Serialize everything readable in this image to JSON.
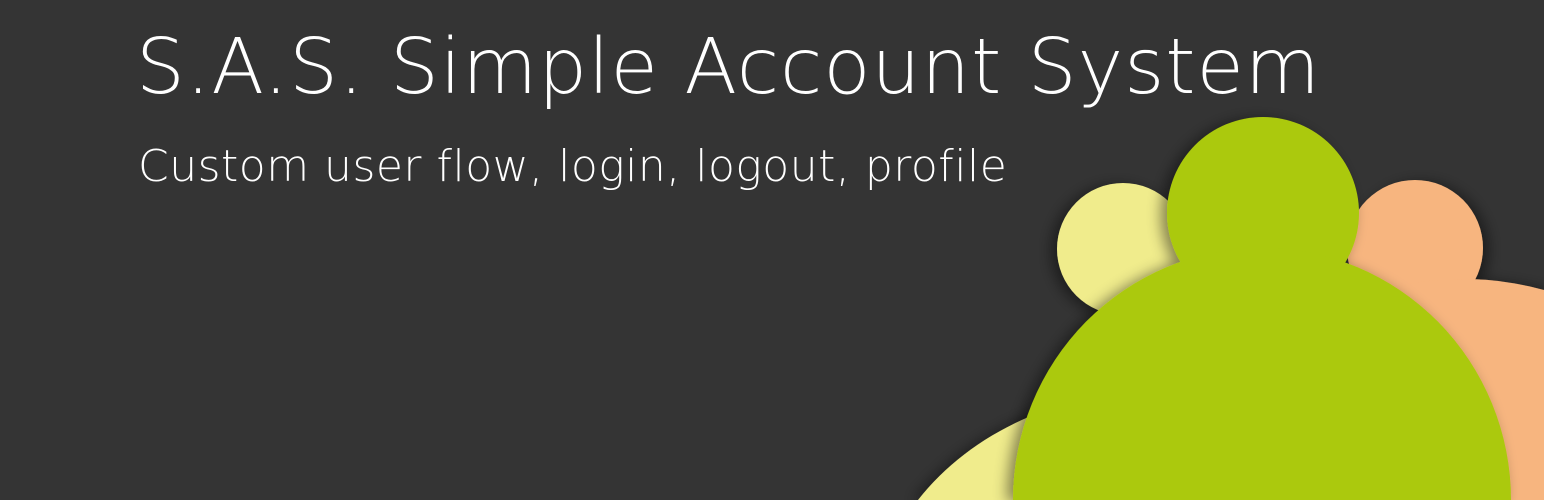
{
  "banner": {
    "title": "S.A.S. Simple Account System",
    "subtitle": "Custom user flow, login, logout, profile"
  },
  "logo": {
    "icon": "users-group-icon",
    "colors": {
      "background": "#343434",
      "left_figure": "#f0ec8c",
      "right_figure": "#f7b57f",
      "center_figure": "#abc90b",
      "text": "#ffffff"
    }
  }
}
